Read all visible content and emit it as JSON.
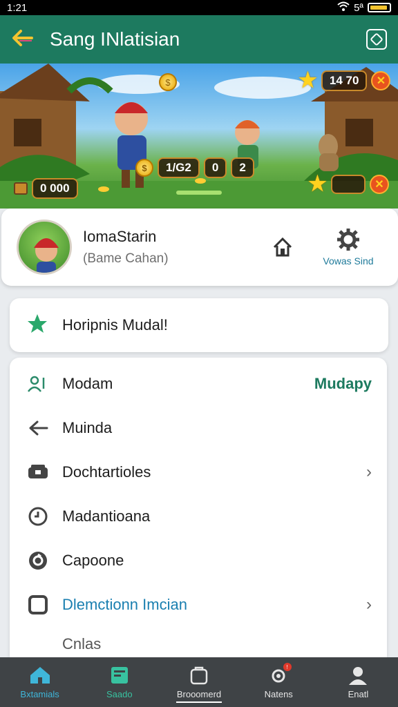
{
  "status_bar": {
    "time": "1:21",
    "signal": "5ª"
  },
  "app_bar": {
    "title": "Sang INlatisian"
  },
  "hero": {
    "top_counter": "14 70",
    "left_counter": "0 000",
    "center_counter_a": "1/G2",
    "center_counter_b": "0",
    "center_counter_c": "2"
  },
  "profile": {
    "name": "IomaStarin",
    "subtitle": "(Bame Cahan)",
    "settings_label": "Vowas Sind"
  },
  "achievement": {
    "label": "Horipnis Mudal!"
  },
  "menu": {
    "items": [
      {
        "label": "Modam",
        "value": "Mudapy",
        "icon": "users-icon"
      },
      {
        "label": "Muinda",
        "icon": "back-arrow-icon"
      },
      {
        "label": "Dochtartioles",
        "icon": "chest-icon",
        "chevron": "›"
      },
      {
        "label": "Madantioana",
        "icon": "clock-icon"
      },
      {
        "label": "Capoone",
        "icon": "refresh-icon"
      },
      {
        "label": "Dlemctionn Imcian",
        "icon": "square-icon",
        "chevron": "›"
      }
    ],
    "partial_label": "Cnlas"
  },
  "bottom_nav": {
    "items": [
      {
        "label": "Bxtamials"
      },
      {
        "label": "Saado"
      },
      {
        "label": "Brooomerd"
      },
      {
        "label": "Natens"
      },
      {
        "label": "Enatl"
      }
    ]
  }
}
